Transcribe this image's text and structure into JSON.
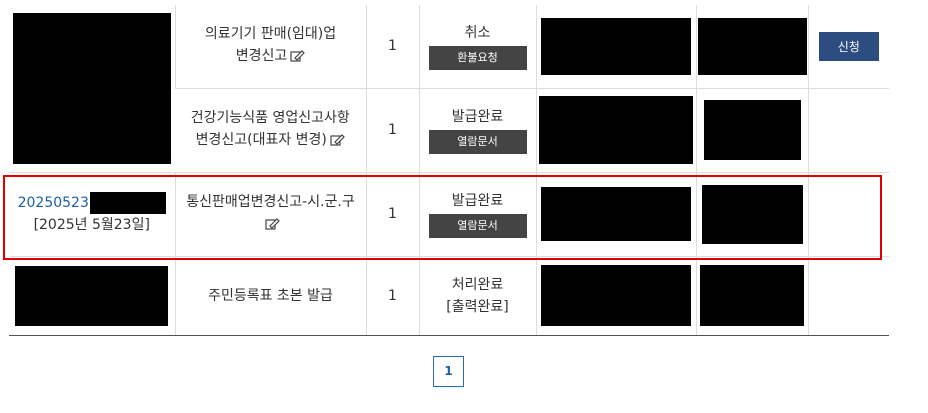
{
  "rows": [
    {
      "name": "의료기기 판매(임대)업 변경신고",
      "count": "1",
      "status": "취소",
      "status_button": "환불요청",
      "action_button": "신청"
    },
    {
      "name": "건강기능식품 영업신고사항 변경신고(대표자 변경)",
      "count": "1",
      "status": "발급완료",
      "status_button": "열람문서"
    },
    {
      "request_no": "20250523",
      "request_date": "[2025년 5월23일]",
      "name": "통신판매업변경신고-시.군.구",
      "count": "1",
      "status": "발급완료",
      "status_button": "열람문서"
    },
    {
      "name": "주민등록표 초본 발급",
      "count": "1",
      "status": "처리완료",
      "status_detail": "[출력완료]"
    }
  ],
  "pagination": {
    "current": "1"
  },
  "icons": {
    "edit": "edit-document-icon"
  },
  "colors": {
    "highlight": "#e00000",
    "accent": "#2b4d7f",
    "link": "#1f5fa8"
  }
}
